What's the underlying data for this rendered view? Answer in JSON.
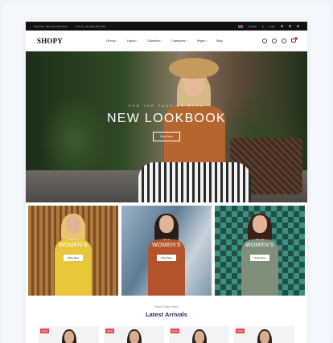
{
  "topbar": {
    "email": "Subscribe: Mon-Sat 9:00-18:00",
    "phone": "Call Us: +00 (123) 456 7890",
    "language": "English",
    "currency": "$",
    "login": "Login"
  },
  "nav": {
    "logo": "SHOPY",
    "menu": [
      "Demos",
      "Layout",
      "Collection",
      "Categories",
      "Pages",
      "Blog"
    ],
    "icons": [
      "search-icon",
      "user-icon",
      "heart-icon",
      "cart-icon"
    ],
    "cart_badge_color": "#e5484d"
  },
  "hero": {
    "subtitle": "FOR THE FASHION WEEK",
    "title": "NEW LOOKBOOK",
    "button": "Shop Now"
  },
  "banners": [
    {
      "small": "Sale Up",
      "title": "WOMEN'S",
      "button": "Shop Now"
    },
    {
      "small": "New In",
      "title": "WOMEN'S",
      "button": "Shop Now"
    },
    {
      "small": "Sale Up",
      "title": "WOMEN'S",
      "button": "Shop Now"
    }
  ],
  "latest": {
    "subtitle": "Shopy Today's Items",
    "title": "Latest Arrivals",
    "products": [
      {
        "badge": "SALE"
      },
      {
        "badge": "SALE"
      },
      {
        "badge": "SALE"
      },
      {
        "badge": "SALE"
      }
    ]
  },
  "colors": {
    "accent": "#e5484d",
    "title": "#1e2a5a"
  }
}
